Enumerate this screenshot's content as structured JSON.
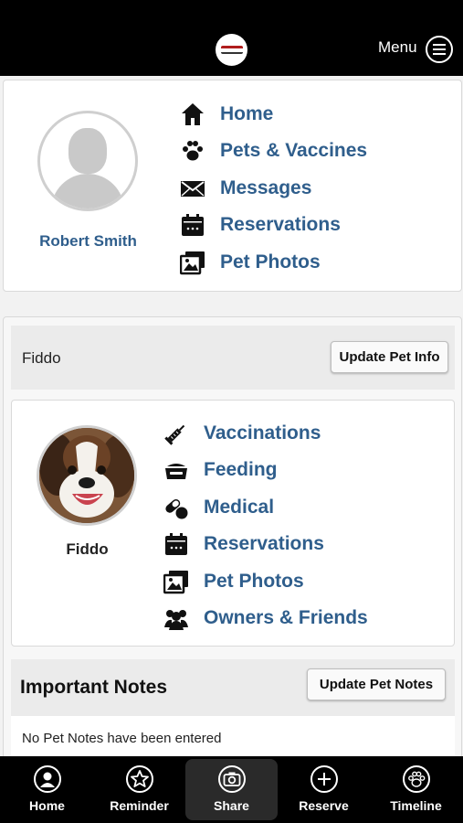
{
  "header": {
    "menu_label": "Menu"
  },
  "profile": {
    "name": "Robert Smith",
    "nav": [
      {
        "label": "Home",
        "icon": "home-icon"
      },
      {
        "label": "Pets & Vaccines",
        "icon": "paw-icon"
      },
      {
        "label": "Messages",
        "icon": "envelope-icon"
      },
      {
        "label": "Reservations",
        "icon": "calendar-icon"
      },
      {
        "label": "Pet Photos",
        "icon": "photos-icon"
      }
    ]
  },
  "pet": {
    "header_name": "Fiddo",
    "update_info_label": "Update Pet Info",
    "name": "Fiddo",
    "nav": [
      {
        "label": "Vaccinations",
        "icon": "syringe-icon"
      },
      {
        "label": "Feeding",
        "icon": "food-bowl-icon"
      },
      {
        "label": "Medical",
        "icon": "pills-icon"
      },
      {
        "label": "Reservations",
        "icon": "calendar-icon"
      },
      {
        "label": "Pet Photos",
        "icon": "photos-icon"
      },
      {
        "label": "Owners & Friends",
        "icon": "users-icon"
      }
    ]
  },
  "notes": {
    "title": "Important Notes",
    "update_label": "Update Pet Notes",
    "empty_text": "No Pet Notes have been entered"
  },
  "tabbar": {
    "tabs": [
      {
        "label": "Home",
        "icon": "user-circle-icon"
      },
      {
        "label": "Reminder",
        "icon": "star-icon"
      },
      {
        "label": "Share",
        "icon": "camera-icon",
        "active": true
      },
      {
        "label": "Reserve",
        "icon": "plus-icon"
      },
      {
        "label": "Timeline",
        "icon": "paw-icon"
      }
    ]
  },
  "colors": {
    "link": "#2f5e8c",
    "topbar": "#000000",
    "tabbar": "#000000"
  }
}
